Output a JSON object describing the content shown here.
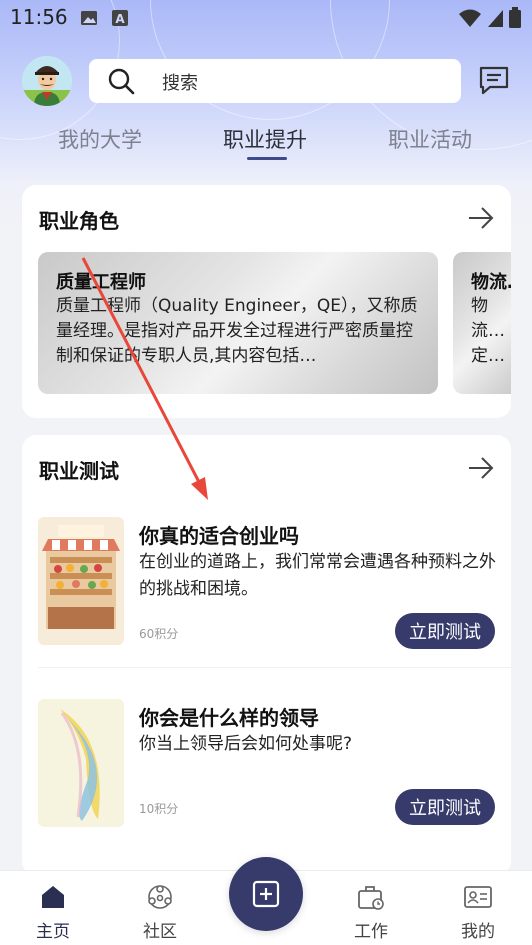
{
  "status_bar": {
    "time": "11:56"
  },
  "search": {
    "placeholder": "搜索"
  },
  "tabs": [
    {
      "label": "我的大学",
      "active": false
    },
    {
      "label": "职业提升",
      "active": true
    },
    {
      "label": "职业活动",
      "active": false
    }
  ],
  "career_roles": {
    "title": "职业角色",
    "items": [
      {
        "name": "质量工程师",
        "description": "质量工程师（Quality Engineer，QE），又称质量经理。是指对产品开发全过程进行严密质量控制和保证的专职人员,其内容包括…"
      },
      {
        "name": "物流…",
        "description": "物流…定物…心规…"
      }
    ]
  },
  "career_tests": {
    "title": "职业测试",
    "items": [
      {
        "title": "你真的适合创业吗",
        "description": "在创业的道路上，我们常常会遭遇各种预料之外的挑战和困境。",
        "points": "60积分",
        "button": "立即测试"
      },
      {
        "title": "你会是什么样的领导",
        "description": "你当上领导后会如何处事呢?",
        "points": "10积分",
        "button": "立即测试"
      }
    ]
  },
  "bottom_nav": {
    "items": [
      {
        "label": "主页",
        "icon": "home-icon",
        "active": true
      },
      {
        "label": "社区",
        "icon": "community-icon",
        "active": false
      },
      {
        "label": "",
        "icon": "add-icon",
        "active": false
      },
      {
        "label": "工作",
        "icon": "work-icon",
        "active": false
      },
      {
        "label": "我的",
        "icon": "profile-card-icon",
        "active": false
      }
    ]
  },
  "colors": {
    "accent": "#363b6b",
    "header_gradient_top": "#aab8f7",
    "annotation_arrow": "#e8473a"
  }
}
